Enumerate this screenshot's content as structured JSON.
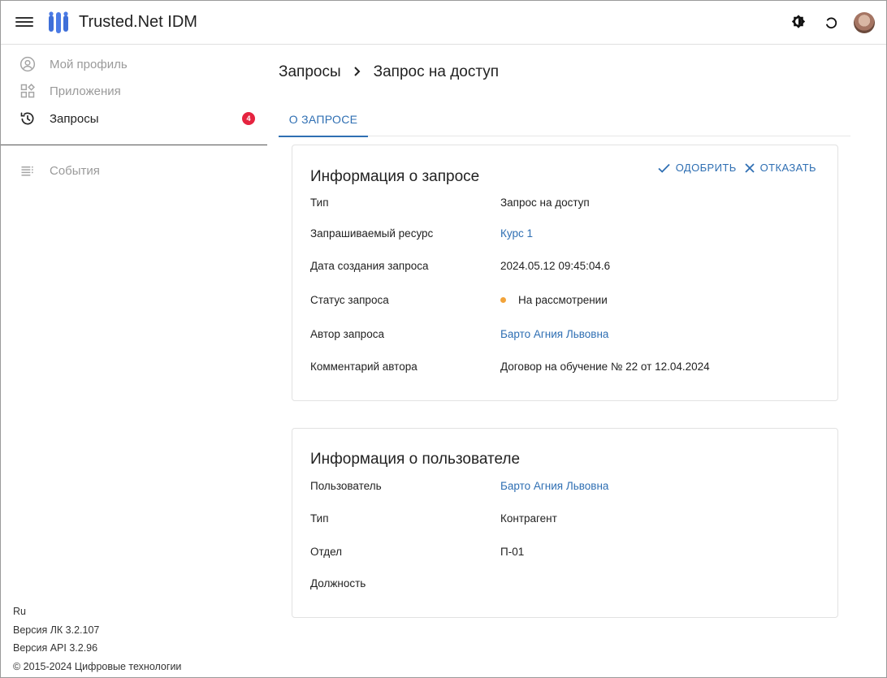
{
  "app": {
    "title": "Trusted.Net IDM"
  },
  "sidebar": {
    "items": [
      {
        "label": "Мой профиль",
        "icon": "account-circle-icon",
        "disabled": true
      },
      {
        "label": "Приложения",
        "icon": "apps-icon",
        "disabled": true
      },
      {
        "label": "Запросы",
        "icon": "history-icon",
        "disabled": false,
        "badge": "4"
      },
      {
        "label": "События",
        "icon": "list-icon",
        "disabled": true
      }
    ]
  },
  "footer": {
    "lang": "Ru",
    "version_lk": "Версия ЛК 3.2.107",
    "version_api": "Версия API 3.2.96",
    "copyright": "© 2015-2024 Цифровые технологии"
  },
  "breadcrumb": {
    "parent": "Запросы",
    "current": "Запрос на доступ"
  },
  "tabs": [
    {
      "label": "О ЗАПРОСЕ",
      "active": true
    }
  ],
  "request_card": {
    "title": "Информация о запросе",
    "approve_label": "ОДОБРИТЬ",
    "reject_label": "ОТКАЗАТЬ",
    "rows": [
      {
        "label": "Тип",
        "value": "Запрос на доступ"
      },
      {
        "label": "Запрашиваемый ресурс",
        "value": "Курс 1",
        "link": true
      },
      {
        "label": "Дата создания запроса",
        "value": "2024.05.12 09:45:04.6"
      },
      {
        "label": "Статус запроса",
        "value": "На рассмотрении",
        "status_color": "#f2a33a"
      },
      {
        "label": "Автор запроса",
        "value": "Барто Агния Львовна",
        "link": true
      },
      {
        "label": "Комментарий автора",
        "value": "Договор на обучение № 22 от 12.04.2024"
      }
    ]
  },
  "user_card": {
    "title": "Информация о пользователе",
    "rows": [
      {
        "label": "Пользователь",
        "value": "Барто Агния Львовна",
        "link": true
      },
      {
        "label": "Тип",
        "value": "Контрагент"
      },
      {
        "label": "Отдел",
        "value": "П-01"
      },
      {
        "label": "Должность",
        "value": ""
      }
    ]
  },
  "colors": {
    "accent": "#2f6fb3",
    "badge": "#e5233f",
    "status_pending": "#f2a33a"
  }
}
